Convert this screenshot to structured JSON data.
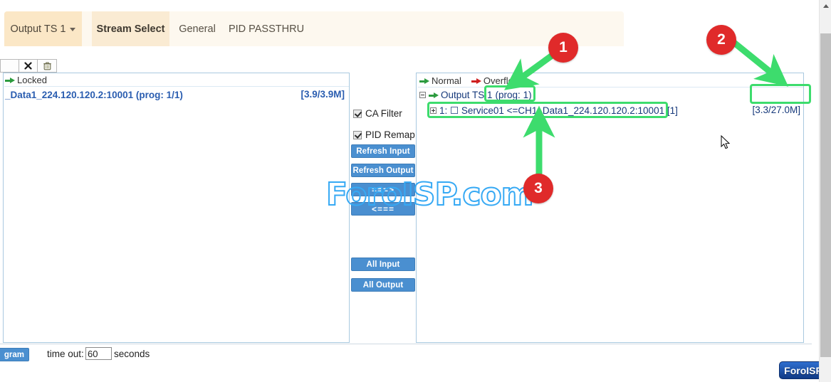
{
  "tabs": [
    {
      "label": "Output TS 1",
      "has_caret": true,
      "active": false,
      "name": "tab-output-ts-1"
    },
    {
      "label": "Stream Select",
      "has_caret": false,
      "active": true,
      "name": "tab-stream-select"
    },
    {
      "label": "General",
      "has_caret": false,
      "active": false,
      "name": "tab-general"
    },
    {
      "label": "PID PASSTHRU",
      "has_caret": false,
      "active": false,
      "name": "tab-pid-passthru"
    }
  ],
  "left_panel": {
    "toolbar": {
      "close_icon": "close-x-icon",
      "delete_icon": "trash-icon"
    },
    "locked_label": "Locked",
    "locked_arrow_icon": "green-arrow-icon",
    "stream": {
      "label": "_Data1_224.120.120.2:10001 (prog: 1/1)",
      "bitrate": "[3.9/3.9M]"
    }
  },
  "middle_column": {
    "checkboxes": [
      {
        "label": "CA Filter",
        "checked": true
      },
      {
        "label": "PID Remap",
        "checked": true
      }
    ],
    "buttons": [
      {
        "label": "Refresh Input",
        "name": "refresh-input-button"
      },
      {
        "label": "Refresh Output",
        "name": "refresh-output-button"
      },
      {
        "label": "===>",
        "name": "move-right-button"
      },
      {
        "label": "<===",
        "name": "move-left-button"
      },
      {
        "label": "All Input",
        "name": "all-input-button"
      },
      {
        "label": "All Output",
        "name": "all-output-button"
      }
    ]
  },
  "right_panel": {
    "legend": {
      "normal_label": "Normal",
      "normal_icon": "green-arrow-icon",
      "overflow_label": "Overflow",
      "overflow_icon": "red-arrow-icon"
    },
    "tree": {
      "output_ts": {
        "label": "Output TS 1",
        "prog": "(prog: 1)",
        "bitrate": "[3.3/27.0M]",
        "expander": "minus",
        "arrow_icon": "green-arrow-icon"
      },
      "service": {
        "label": "1: ☐ Service01 <=CH1_Data1_224.120.120.2:10001 [1]",
        "expander": "plus"
      }
    }
  },
  "annotations": {
    "markers": [
      {
        "number": "1"
      },
      {
        "number": "2"
      },
      {
        "number": "3"
      }
    ],
    "highlight_color": "#3ddc6d",
    "marker_color": "#e02a2a"
  },
  "watermark": {
    "text": "ForoISP.com",
    "color": "#36a9f4"
  },
  "bottom_bar": {
    "program_button": "gram",
    "timeout_label": "time out:",
    "timeout_value": "60",
    "timeout_placeholder": "60",
    "seconds_label": "seconds"
  },
  "badge": {
    "text": "ForoISP"
  }
}
